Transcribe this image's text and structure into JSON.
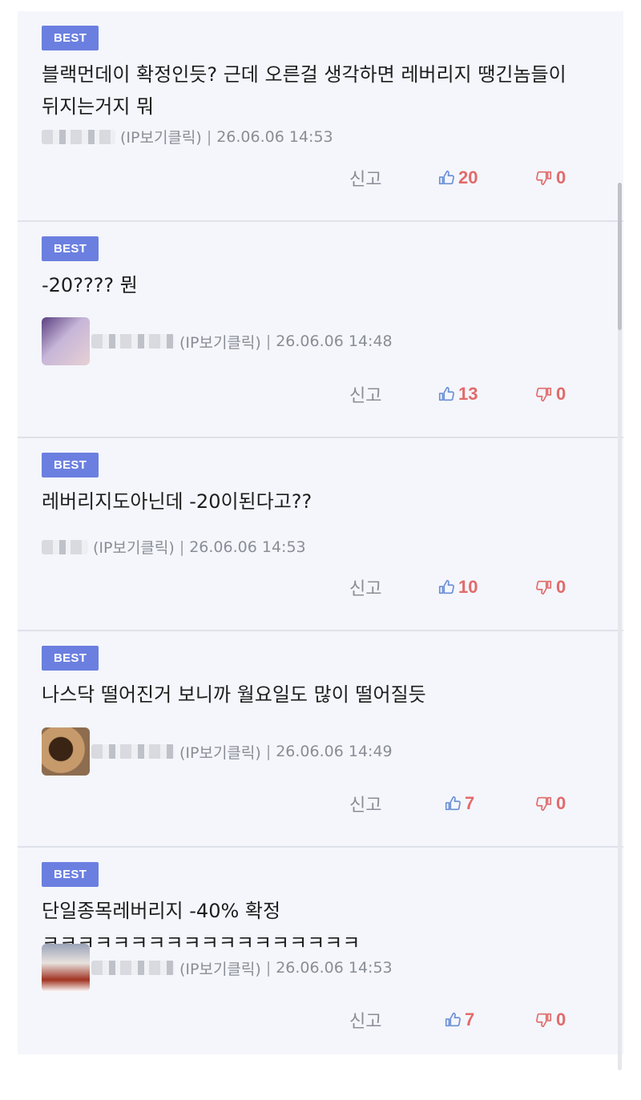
{
  "comments": [
    {
      "badge": "BEST",
      "text": "블랙먼데이 확정인듯? 근데 오른걸 생각하면 레버리지 땡긴놈들이 뒤지는거지 뭐",
      "ip_label": "(IP보기클릭)",
      "separator": "|",
      "timestamp": "26.06.06 14:53",
      "report_label": "신고",
      "likes": "20",
      "dislikes": "0"
    },
    {
      "badge": "BEST",
      "text": "-20????  뭔",
      "ip_label": "(IP보기클릭)",
      "separator": "|",
      "timestamp": "26.06.06 14:48",
      "report_label": "신고",
      "likes": "13",
      "dislikes": "0"
    },
    {
      "badge": "BEST",
      "text": "레버리지도아닌데 -20이된다고??",
      "ip_label": "(IP보기클릭)",
      "separator": "|",
      "timestamp": "26.06.06 14:53",
      "report_label": "신고",
      "likes": "10",
      "dislikes": "0"
    },
    {
      "badge": "BEST",
      "text": "나스닥 떨어진거 보니까 월요일도 많이 떨어질듯",
      "ip_label": "(IP보기클릭)",
      "separator": "|",
      "timestamp": "26.06.06 14:49",
      "report_label": "신고",
      "likes": "7",
      "dislikes": "0"
    },
    {
      "badge": "BEST",
      "text": "단일종목레버리지 -40% 확정 ㅋㅋㅋㅋㅋㅋㅋㅋㅋㅋㅋㅋㅋㅋㅋㅋㅋㅋ",
      "ip_label": "(IP보기클릭)",
      "separator": "|",
      "timestamp": "26.06.06 14:53",
      "report_label": "신고",
      "likes": "7",
      "dislikes": "0"
    }
  ],
  "colors": {
    "badge_bg": "#6b7fe0",
    "card_bg": "#f4f6fb",
    "vote_count": "#e26a6a",
    "thumb_up_icon": "#6b8fd6",
    "thumb_down_icon": "#e26a6a"
  },
  "icons": {
    "thumb_up": "thumbs-up-icon",
    "thumb_down": "thumbs-down-icon"
  }
}
